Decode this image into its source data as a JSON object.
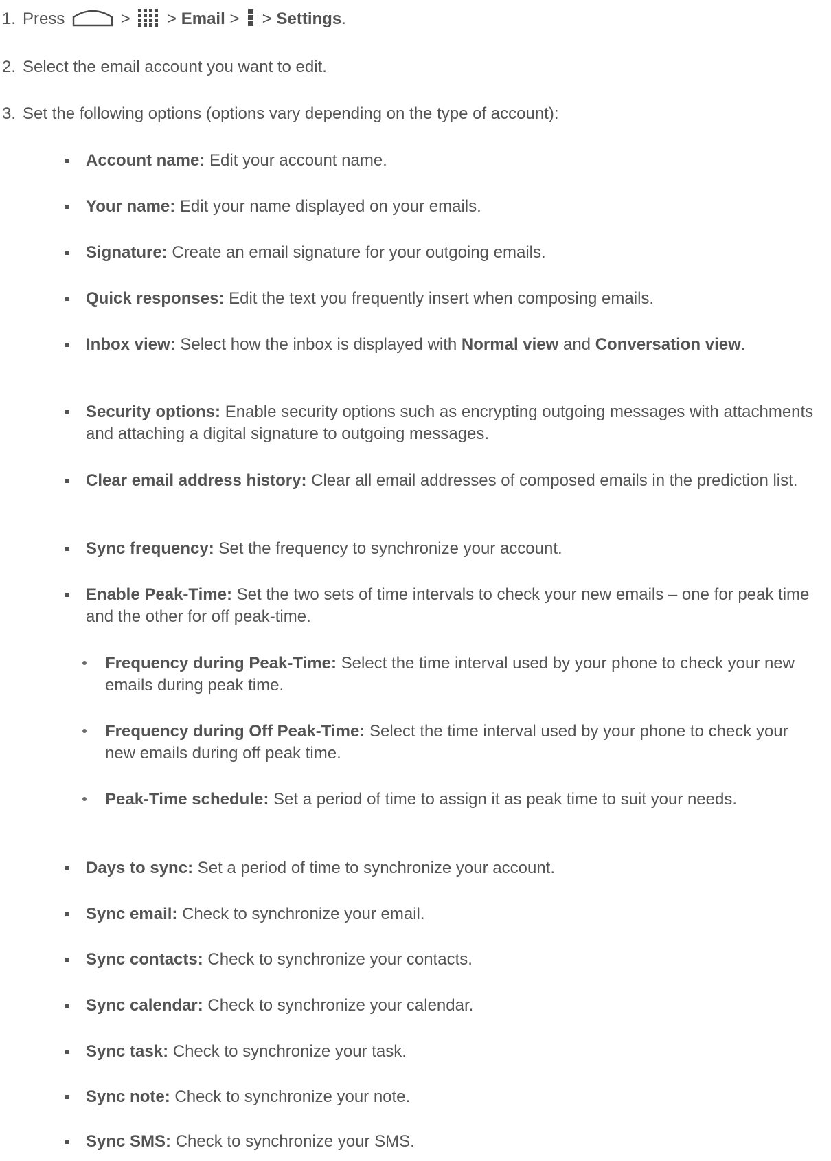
{
  "steps": [
    {
      "num": "1.",
      "press": "Press",
      "sep1": ">",
      "sep2": ">",
      "email": "Email",
      "sep3": ">",
      "sep4": ">",
      "settings": "Settings",
      "end": ".",
      "icons": [
        "home-icon",
        "apps-grid-icon",
        "menu-icon"
      ]
    },
    {
      "num": "2.",
      "text": "Select the email account you want to edit."
    },
    {
      "num": "3.",
      "text": "Set the following options (options vary depending on the type of account):"
    }
  ],
  "options": [
    {
      "label": "Account name:",
      "text": " Edit your account name."
    },
    {
      "label": "Your name:",
      "text": " Edit your name displayed on your emails."
    },
    {
      "label": "Signature:",
      "text": " Create an email signature for your outgoing emails."
    },
    {
      "label": "Quick responses:",
      "text": " Edit the text you frequently insert when composing emails."
    },
    {
      "label": "Inbox view:",
      "text": " Select how the inbox is displayed with ",
      "b1": "Normal view",
      "mid": " and ",
      "b2": "Conversation view",
      "end": "."
    },
    {
      "label": "Security options:",
      "text": " Enable security options such as encrypting outgoing messages with attachments and attaching a digital signature to outgoing messages."
    },
    {
      "label": "Clear email address history:",
      "text": " Clear all email addresses of composed emails in the prediction list."
    },
    {
      "label": "Sync frequency:",
      "text": " Set the frequency to synchronize your account."
    },
    {
      "label": "Enable Peak-Time:",
      "text": " Set the two sets of time intervals to check your new emails – one for peak time and the other for off peak-time."
    }
  ],
  "sub_options": [
    {
      "label": "Frequency during Peak-Time:",
      "text": " Select the time interval used by your phone to check your new emails during peak time."
    },
    {
      "label": "Frequency during Off Peak-Time:",
      "text": " Select the time interval used by your phone to check your new emails during off peak time."
    },
    {
      "label": "Peak-Time schedule:",
      "text": " Set a period of time to assign it as peak time to suit your needs."
    }
  ],
  "more_options": [
    {
      "label": "Days to sync:",
      "text": " Set a period of time to synchronize your account."
    },
    {
      "label": "Sync email:",
      "text": " Check to synchronize your email."
    },
    {
      "label": "Sync contacts:",
      "text": " Check to synchronize your contacts."
    },
    {
      "label": "Sync calendar:",
      "text": " Check to synchronize your calendar."
    },
    {
      "label": "Sync task:",
      "text": " Check to synchronize your task."
    },
    {
      "label": "Sync note:",
      "text": " Check to synchronize your note."
    },
    {
      "label": "Sync SMS:",
      "text": " Check to synchronize your SMS."
    }
  ],
  "colors": {
    "text": "#545454",
    "icon": "#4a4a4a"
  }
}
